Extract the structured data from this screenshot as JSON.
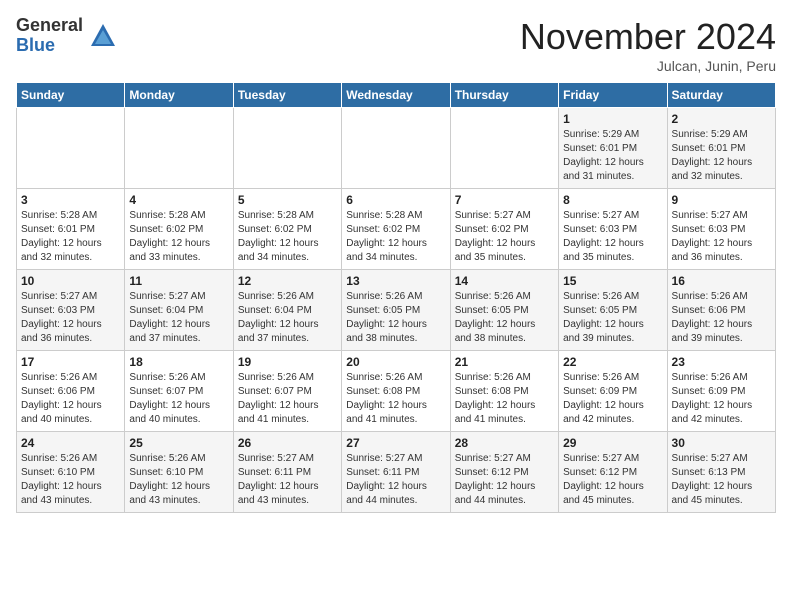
{
  "header": {
    "logo_general": "General",
    "logo_blue": "Blue",
    "month_title": "November 2024",
    "subtitle": "Julcan, Junin, Peru"
  },
  "weekdays": [
    "Sunday",
    "Monday",
    "Tuesday",
    "Wednesday",
    "Thursday",
    "Friday",
    "Saturday"
  ],
  "weeks": [
    [
      {
        "day": "",
        "info": ""
      },
      {
        "day": "",
        "info": ""
      },
      {
        "day": "",
        "info": ""
      },
      {
        "day": "",
        "info": ""
      },
      {
        "day": "",
        "info": ""
      },
      {
        "day": "1",
        "info": "Sunrise: 5:29 AM\nSunset: 6:01 PM\nDaylight: 12 hours and 31 minutes."
      },
      {
        "day": "2",
        "info": "Sunrise: 5:29 AM\nSunset: 6:01 PM\nDaylight: 12 hours and 32 minutes."
      }
    ],
    [
      {
        "day": "3",
        "info": "Sunrise: 5:28 AM\nSunset: 6:01 PM\nDaylight: 12 hours and 32 minutes."
      },
      {
        "day": "4",
        "info": "Sunrise: 5:28 AM\nSunset: 6:02 PM\nDaylight: 12 hours and 33 minutes."
      },
      {
        "day": "5",
        "info": "Sunrise: 5:28 AM\nSunset: 6:02 PM\nDaylight: 12 hours and 34 minutes."
      },
      {
        "day": "6",
        "info": "Sunrise: 5:28 AM\nSunset: 6:02 PM\nDaylight: 12 hours and 34 minutes."
      },
      {
        "day": "7",
        "info": "Sunrise: 5:27 AM\nSunset: 6:02 PM\nDaylight: 12 hours and 35 minutes."
      },
      {
        "day": "8",
        "info": "Sunrise: 5:27 AM\nSunset: 6:03 PM\nDaylight: 12 hours and 35 minutes."
      },
      {
        "day": "9",
        "info": "Sunrise: 5:27 AM\nSunset: 6:03 PM\nDaylight: 12 hours and 36 minutes."
      }
    ],
    [
      {
        "day": "10",
        "info": "Sunrise: 5:27 AM\nSunset: 6:03 PM\nDaylight: 12 hours and 36 minutes."
      },
      {
        "day": "11",
        "info": "Sunrise: 5:27 AM\nSunset: 6:04 PM\nDaylight: 12 hours and 37 minutes."
      },
      {
        "day": "12",
        "info": "Sunrise: 5:26 AM\nSunset: 6:04 PM\nDaylight: 12 hours and 37 minutes."
      },
      {
        "day": "13",
        "info": "Sunrise: 5:26 AM\nSunset: 6:05 PM\nDaylight: 12 hours and 38 minutes."
      },
      {
        "day": "14",
        "info": "Sunrise: 5:26 AM\nSunset: 6:05 PM\nDaylight: 12 hours and 38 minutes."
      },
      {
        "day": "15",
        "info": "Sunrise: 5:26 AM\nSunset: 6:05 PM\nDaylight: 12 hours and 39 minutes."
      },
      {
        "day": "16",
        "info": "Sunrise: 5:26 AM\nSunset: 6:06 PM\nDaylight: 12 hours and 39 minutes."
      }
    ],
    [
      {
        "day": "17",
        "info": "Sunrise: 5:26 AM\nSunset: 6:06 PM\nDaylight: 12 hours and 40 minutes."
      },
      {
        "day": "18",
        "info": "Sunrise: 5:26 AM\nSunset: 6:07 PM\nDaylight: 12 hours and 40 minutes."
      },
      {
        "day": "19",
        "info": "Sunrise: 5:26 AM\nSunset: 6:07 PM\nDaylight: 12 hours and 41 minutes."
      },
      {
        "day": "20",
        "info": "Sunrise: 5:26 AM\nSunset: 6:08 PM\nDaylight: 12 hours and 41 minutes."
      },
      {
        "day": "21",
        "info": "Sunrise: 5:26 AM\nSunset: 6:08 PM\nDaylight: 12 hours and 41 minutes."
      },
      {
        "day": "22",
        "info": "Sunrise: 5:26 AM\nSunset: 6:09 PM\nDaylight: 12 hours and 42 minutes."
      },
      {
        "day": "23",
        "info": "Sunrise: 5:26 AM\nSunset: 6:09 PM\nDaylight: 12 hours and 42 minutes."
      }
    ],
    [
      {
        "day": "24",
        "info": "Sunrise: 5:26 AM\nSunset: 6:10 PM\nDaylight: 12 hours and 43 minutes."
      },
      {
        "day": "25",
        "info": "Sunrise: 5:26 AM\nSunset: 6:10 PM\nDaylight: 12 hours and 43 minutes."
      },
      {
        "day": "26",
        "info": "Sunrise: 5:27 AM\nSunset: 6:11 PM\nDaylight: 12 hours and 43 minutes."
      },
      {
        "day": "27",
        "info": "Sunrise: 5:27 AM\nSunset: 6:11 PM\nDaylight: 12 hours and 44 minutes."
      },
      {
        "day": "28",
        "info": "Sunrise: 5:27 AM\nSunset: 6:12 PM\nDaylight: 12 hours and 44 minutes."
      },
      {
        "day": "29",
        "info": "Sunrise: 5:27 AM\nSunset: 6:12 PM\nDaylight: 12 hours and 45 minutes."
      },
      {
        "day": "30",
        "info": "Sunrise: 5:27 AM\nSunset: 6:13 PM\nDaylight: 12 hours and 45 minutes."
      }
    ]
  ]
}
